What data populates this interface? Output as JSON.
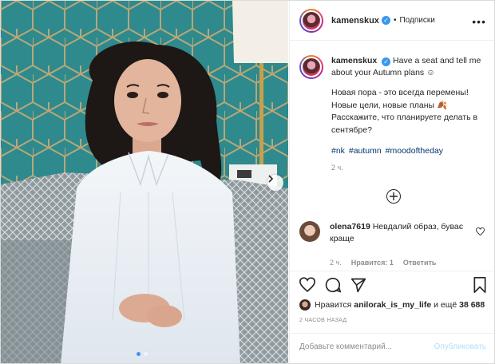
{
  "post": {
    "username": "kamenskux",
    "verified_mark": "✓",
    "separator": "•",
    "follow_label": "Подписки",
    "more_icon": "more-horizontal-icon",
    "caption_en": "Have a seat and tell me about your Autumn plans ☺",
    "caption_ru": "Новая пора - это всегда перемены! Новые цели, новые планы 🍂 Расскажите, что планируете делать в сентябре?",
    "hashtags": [
      "#nk",
      "#autumn",
      "#moodoftheday"
    ],
    "posted_ago": "2 ч."
  },
  "comment": {
    "username": "olena7619",
    "text": "Невдалий образ, буває краще",
    "time": "2 ч.",
    "likes_label": "Нравится: 1",
    "reply_label": "Ответить"
  },
  "likes": {
    "prefix": "Нравится",
    "user": "anilorak_is_my_life",
    "suffix": "и ещё",
    "count": "38 688"
  },
  "timestamp": "2 ЧАСОВ НАЗАД",
  "add_comment": {
    "placeholder": "Добавьте комментарий...",
    "publish_label": "Опубликовать"
  },
  "carousel": {
    "current": 1,
    "total": 2
  },
  "colors": {
    "link": "#00376b",
    "accent": "#3897f0",
    "publish_disabled": "#b2dffc",
    "wall": "#2f8c8d"
  }
}
